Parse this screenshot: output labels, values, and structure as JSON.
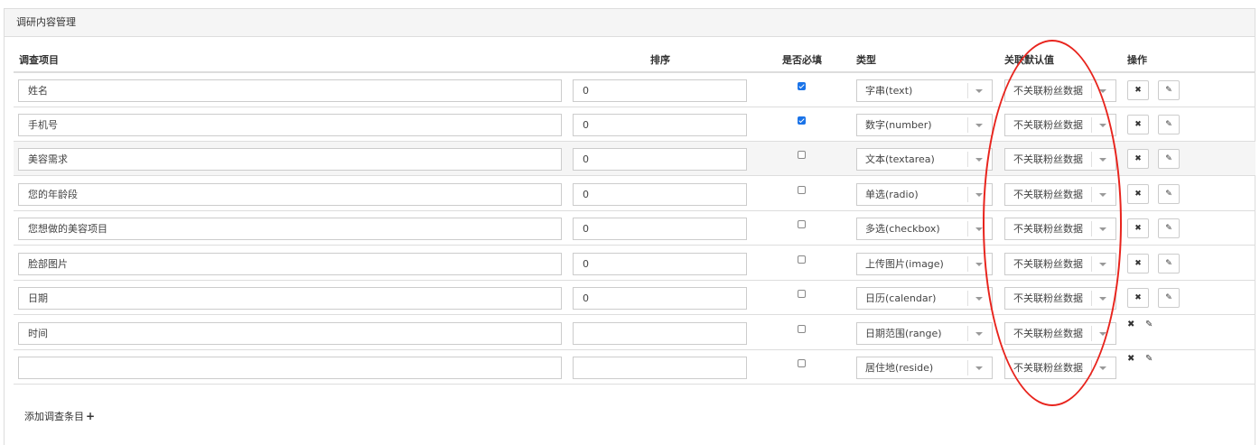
{
  "panel": {
    "title": "调研内容管理"
  },
  "columns": {
    "item": "调查项目",
    "sort": "排序",
    "required": "是否必填",
    "type": "类型",
    "default": "关联默认值",
    "ops": "操作"
  },
  "rows": [
    {
      "name": "姓名",
      "sort": "0",
      "required": true,
      "type": "字串(text)",
      "default": "不关联粉丝数据"
    },
    {
      "name": "手机号",
      "sort": "0",
      "required": true,
      "type": "数字(number)",
      "default": "不关联粉丝数据"
    },
    {
      "name": "美容需求",
      "sort": "0",
      "required": false,
      "type": "文本(textarea)",
      "default": "不关联粉丝数据"
    },
    {
      "name": "您的年龄段",
      "sort": "0",
      "required": false,
      "type": "单选(radio)",
      "default": "不关联粉丝数据"
    },
    {
      "name": "您想做的美容项目",
      "sort": "0",
      "required": false,
      "type": "多选(checkbox)",
      "default": "不关联粉丝数据"
    },
    {
      "name": "脸部图片",
      "sort": "0",
      "required": false,
      "type": "上传图片(image)",
      "default": "不关联粉丝数据"
    },
    {
      "name": "日期",
      "sort": "0",
      "required": false,
      "type": "日历(calendar)",
      "default": "不关联粉丝数据"
    },
    {
      "name": "时间",
      "sort": "",
      "required": false,
      "type": "日期范围(range)",
      "default": "不关联粉丝数据"
    },
    {
      "name": "",
      "sort": "",
      "required": false,
      "type": "居住地(reside)",
      "default": "不关联粉丝数据"
    }
  ],
  "icons": {
    "delete": "✖",
    "edit": "✎"
  },
  "add_link": {
    "label": "添加调查条目",
    "icon": "+"
  },
  "colors": {
    "annotation": "#e8241d",
    "checkbox_checked": "#1a73e8"
  }
}
